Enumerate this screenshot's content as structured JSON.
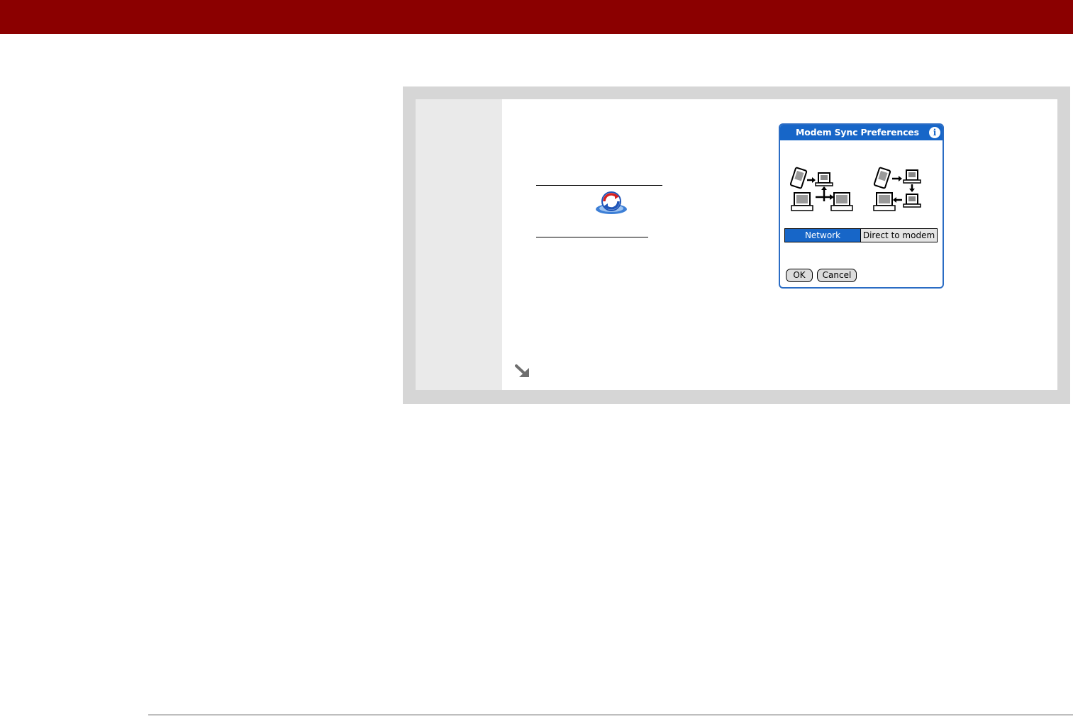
{
  "colors": {
    "header_bar": "#8b0000",
    "panel_frame": "#d6d6d6",
    "number_column": "#eaeaea",
    "palm_blue": "#1766c8",
    "palm_button": "#dcdcdc"
  },
  "icons": {
    "hotsync": "hotsync-icon",
    "next_step": "next-step-arrow-icon",
    "info": "info-icon"
  },
  "dialog": {
    "title": "Modem Sync Preferences",
    "info_glyph": "i",
    "segments": {
      "network": "Network",
      "direct": "Direct to modem",
      "selected": "Network"
    },
    "buttons": {
      "ok": "OK",
      "cancel": "Cancel"
    }
  }
}
